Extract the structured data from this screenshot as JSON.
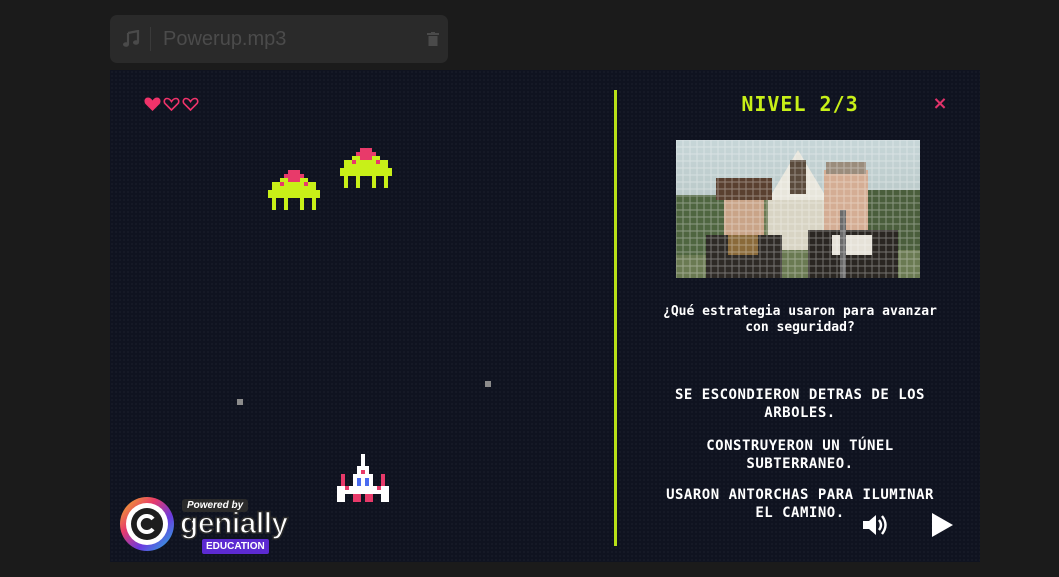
{
  "audio": {
    "filename": "Powerup.mp3",
    "note_icon": "music-note-icon",
    "trash_icon": "trash-icon"
  },
  "game": {
    "lives": {
      "filled": 1,
      "total": 3
    },
    "level_title": "NIVEL 2/3",
    "close_label": "×",
    "question": "¿Qué estrategia usaron para avanzar con seguridad?",
    "answers": [
      "SE ESCONDIERON DETRAS DE LOS ARBOLES.",
      "CONSTRUYERON UN TÚNEL SUBTERRANEO.",
      "USARON ANTORCHAS PARA ILUMINAR EL CAMINO."
    ],
    "colors": {
      "accent": "#c8f018",
      "heart": "#f0336a",
      "close": "#e0336a",
      "background": "#0f1320"
    }
  },
  "branding": {
    "powered": "Powered by",
    "name": "genially",
    "edition": "EDUCATION"
  },
  "controls": {
    "volume_icon": "speaker-icon",
    "play_icon": "play-icon"
  }
}
